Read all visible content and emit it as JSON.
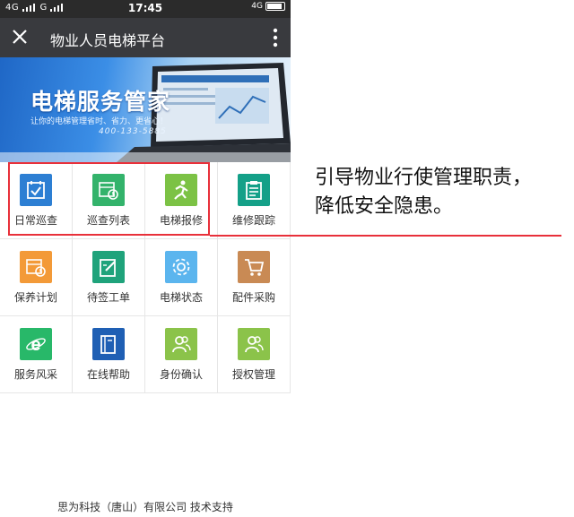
{
  "status": {
    "signal": "4G ᴵᴵᴵ Gᴵᴵᴵ",
    "signal_left_a": "4G",
    "signal_left_b": "G",
    "time": "17:45",
    "network_right": "4G",
    "battery_level": 0.9
  },
  "nav": {
    "title": "物业人员电梯平台"
  },
  "banner": {
    "title": "电梯服务管家",
    "subtitle": "让你的电梯管理省时、省力、更省心！",
    "phone": "400-133-5885"
  },
  "menu": [
    {
      "label": "日常巡查",
      "icon": "checkbox-calendar-icon",
      "color": "#2d7fd3"
    },
    {
      "label": "巡查列表",
      "icon": "calendar-clock-icon",
      "color": "#33b36b"
    },
    {
      "label": "电梯报修",
      "icon": "person-running-icon",
      "color": "#7cc245"
    },
    {
      "label": "维修跟踪",
      "icon": "clipboard-list-icon",
      "color": "#14a088"
    },
    {
      "label": "保养计划",
      "icon": "calendar-clock-icon",
      "color": "#f39a38"
    },
    {
      "label": "待签工单",
      "icon": "edit-document-icon",
      "color": "#1fa37b"
    },
    {
      "label": "电梯状态",
      "icon": "gear-icon",
      "color": "#5bb5ee"
    },
    {
      "label": "配件采购",
      "icon": "cart-icon",
      "color": "#c98a54"
    },
    {
      "label": "服务风采",
      "icon": "browser-e-icon",
      "color": "#28b869"
    },
    {
      "label": "在线帮助",
      "icon": "book-icon",
      "color": "#1f5fb4"
    },
    {
      "label": "身份确认",
      "icon": "users-icon",
      "color": "#8bc34a"
    },
    {
      "label": "授权管理",
      "icon": "users-icon",
      "color": "#8bc34a"
    }
  ],
  "footer": "思为科技（唐山）有限公司 技术支持",
  "annotation": {
    "line1": "引导物业行使管理职责，",
    "line2": "降低安全隐患。",
    "color": "#e8303a"
  }
}
